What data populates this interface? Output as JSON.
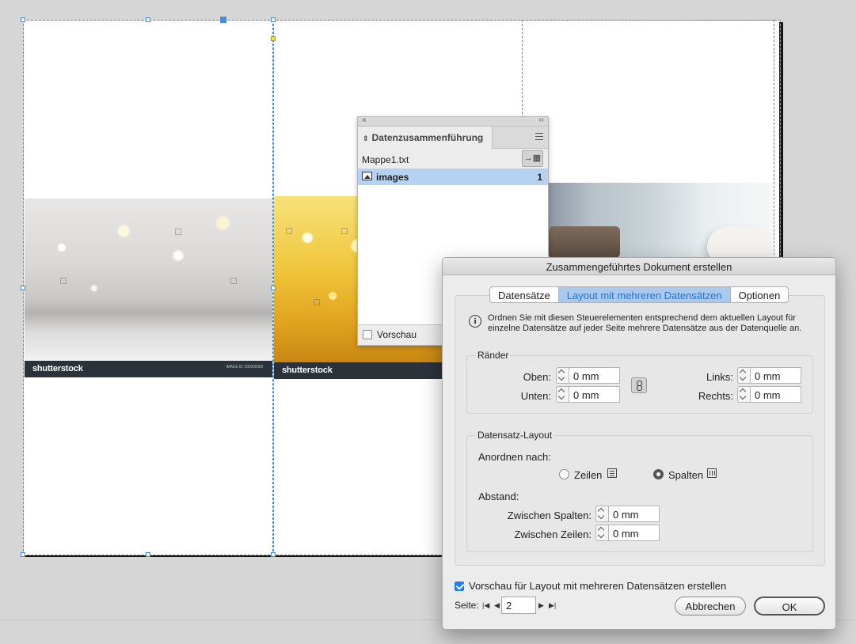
{
  "document": {
    "left_brand": "shutterstock",
    "left_meta": "IMAGE ID: 000000000",
    "middle_brand": "shutterstock"
  },
  "panel": {
    "close_glyph": "×",
    "collapse_glyph": "‹‹",
    "title": "Datenzusammenführung",
    "source_file": "Mappe1.txt",
    "field_name": "images",
    "field_count": "1",
    "preview_label": "Vorschau",
    "preview_checked": false,
    "source_button_icon": "merge-target-icon"
  },
  "dialog": {
    "title": "Zusammengeführtes Dokument erstellen",
    "tabs": [
      {
        "label": "Datensätze",
        "active": false
      },
      {
        "label": "Layout mit mehreren Datensätzen",
        "active": true
      },
      {
        "label": "Optionen",
        "active": false
      }
    ],
    "info_icon": "info-icon",
    "info_text": "Ordnen Sie mit diesen Steuerelementen entsprechend dem aktuellen Layout für einzelne Datensätze auf jeder Seite mehrere Datensätze aus der Datenquelle an.",
    "margins": {
      "group_title": "Ränder",
      "top_label": "Oben:",
      "top_value": "0 mm",
      "bottom_label": "Unten:",
      "bottom_value": "0 mm",
      "left_label": "Links:",
      "left_value": "0 mm",
      "right_label": "Rechts:",
      "right_value": "0 mm"
    },
    "record_layout": {
      "group_title": "Datensatz-Layout",
      "arrange_label": "Anordnen nach:",
      "rows_label": "Zeilen",
      "columns_label": "Spalten",
      "selected": "Spalten",
      "spacing_label": "Abstand:",
      "between_columns_label": "Zwischen Spalten:",
      "between_columns_value": "0 mm",
      "between_rows_label": "Zwischen Zeilen:",
      "between_rows_value": "0 mm"
    },
    "preview_label": "Vorschau für Layout mit mehreren Datensätzen erstellen",
    "preview_checked": true,
    "page_label": "Seite:",
    "page_value": "2",
    "cancel_label": "Abbrechen",
    "ok_label": "OK"
  },
  "colors": {
    "selection": "#3f8fe0",
    "active_tab_bg": "#a9c9ee",
    "active_tab_text": "#1d76de",
    "panel_selected_row": "#b6d2f3"
  }
}
